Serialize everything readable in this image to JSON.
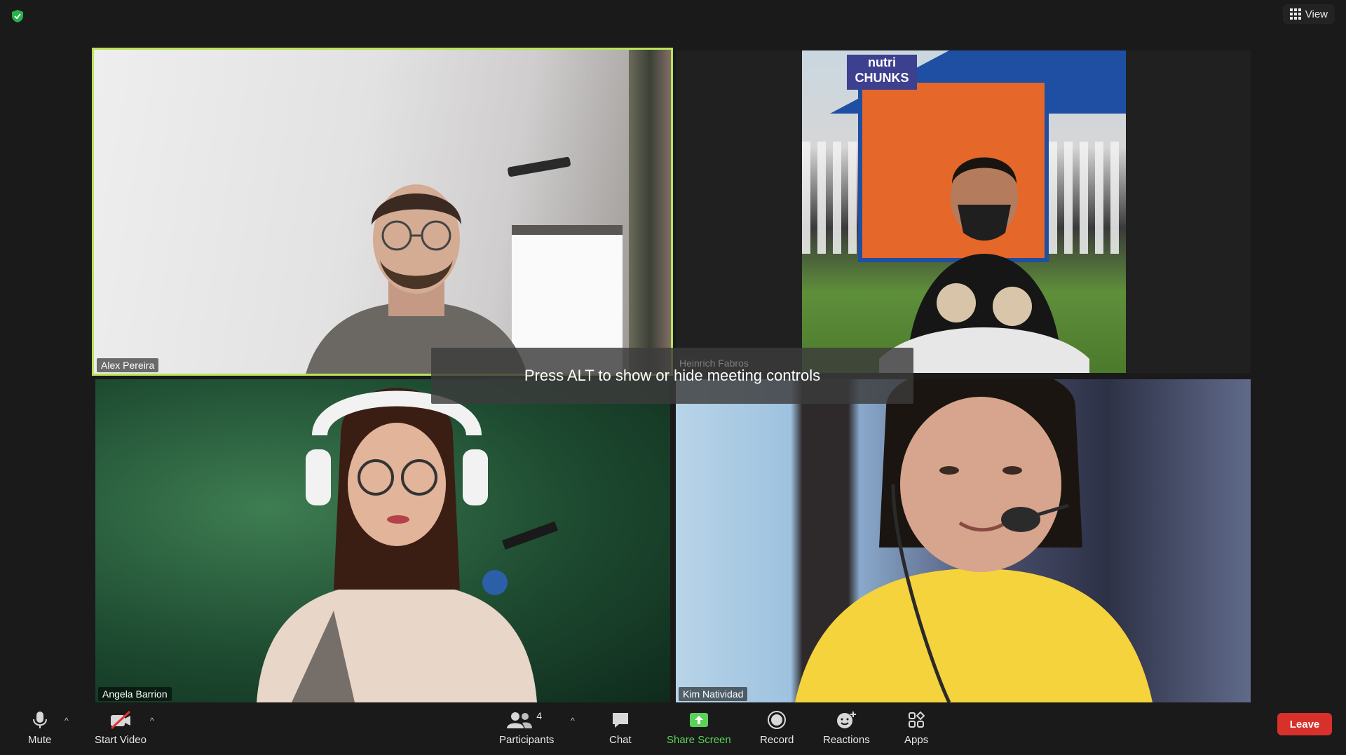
{
  "top": {
    "view_label": "View"
  },
  "participants_grid": [
    {
      "name": "Alex Pereira",
      "active_speaker": true
    },
    {
      "name": "Heinrich Fabros"
    },
    {
      "name": "Angela Barrion"
    },
    {
      "name": "Kim Natividad"
    }
  ],
  "tile2_sign": "nutri CHUNKS",
  "toast": {
    "message": "Press ALT to show or hide meeting controls"
  },
  "toolbar": {
    "mute_label": "Mute",
    "start_video_label": "Start Video",
    "participants_label": "Participants",
    "participants_count": "4",
    "chat_label": "Chat",
    "share_screen_label": "Share Screen",
    "record_label": "Record",
    "reactions_label": "Reactions",
    "apps_label": "Apps",
    "leave_label": "Leave"
  },
  "colors": {
    "active_border": "#b9e35a",
    "share_green": "#5bd15a",
    "leave_red": "#d8302b",
    "background": "#1a1a1a"
  }
}
